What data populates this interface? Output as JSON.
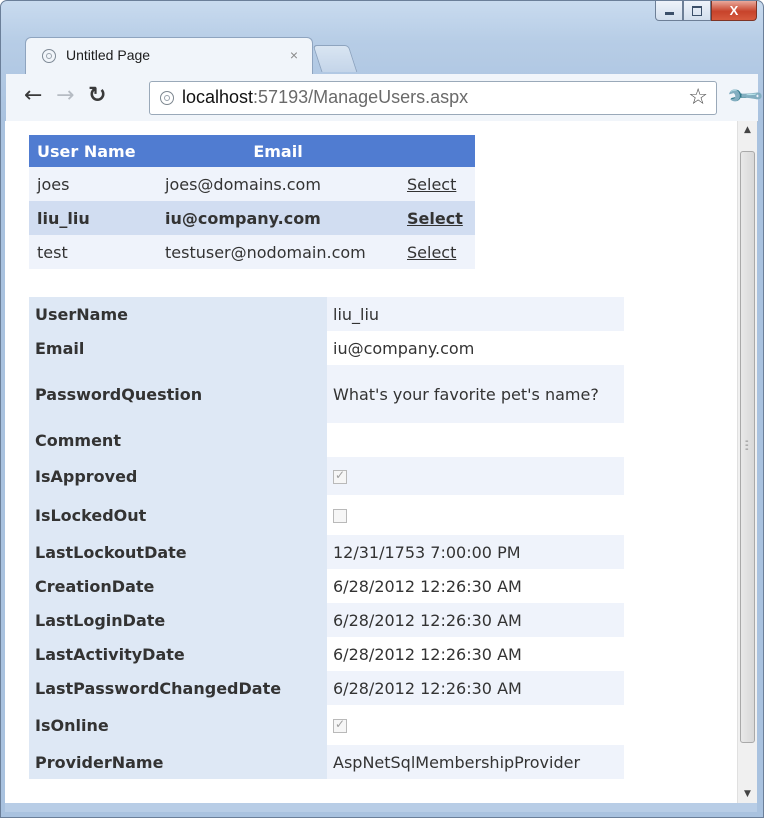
{
  "browser": {
    "tab_title": "Untitled Page",
    "tab_close": "×",
    "url_host": "localhost",
    "url_rest": ":57193/ManageUsers.aspx",
    "window_close": "X"
  },
  "users_grid": {
    "headers": {
      "user_name": "User Name",
      "email": "Email"
    },
    "rows": [
      {
        "user_name": "joes",
        "email": "joes@domains.com",
        "action": "Select"
      },
      {
        "user_name": "liu_liu",
        "email": "iu@company.com",
        "action": "Select"
      },
      {
        "user_name": "test",
        "email": "testuser@nodomain.com",
        "action": "Select"
      }
    ]
  },
  "details": {
    "fields": [
      {
        "label": "UserName",
        "value": "liu_liu"
      },
      {
        "label": "Email",
        "value": "iu@company.com"
      },
      {
        "label": "PasswordQuestion",
        "value": "What's your favorite pet's name?"
      },
      {
        "label": "Comment",
        "value": ""
      },
      {
        "label": "IsApproved",
        "checked": true
      },
      {
        "label": "IsLockedOut",
        "checked": false
      },
      {
        "label": "LastLockoutDate",
        "value": "12/31/1753 7:00:00 PM"
      },
      {
        "label": "CreationDate",
        "value": "6/28/2012 12:26:30 AM"
      },
      {
        "label": "LastLoginDate",
        "value": "6/28/2012 12:26:30 AM"
      },
      {
        "label": "LastActivityDate",
        "value": "6/28/2012 12:26:30 AM"
      },
      {
        "label": "LastPasswordChangedDate",
        "value": "6/28/2012 12:26:30 AM"
      },
      {
        "label": "IsOnline",
        "checked": true
      },
      {
        "label": "ProviderName",
        "value": "AspNetSqlMembershipProvider"
      }
    ]
  },
  "colors": {
    "grid_header": "#507cd1",
    "selected_row": "#d1ddf1",
    "row": "#eff3fb",
    "label_cell": "#dee8f5"
  }
}
